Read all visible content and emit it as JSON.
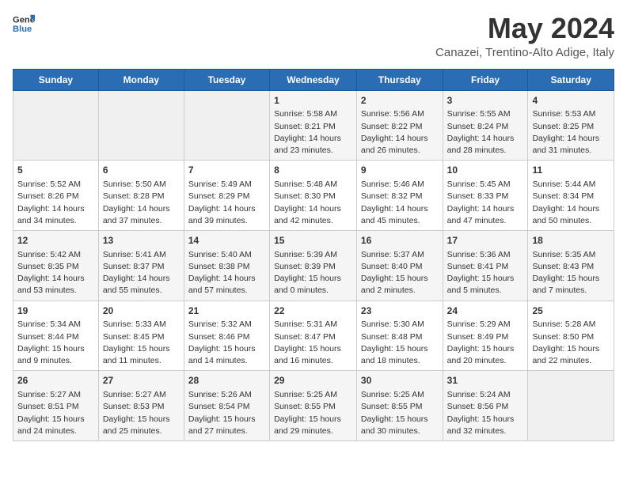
{
  "header": {
    "logo_general": "General",
    "logo_blue": "Blue",
    "title": "May 2024",
    "subtitle": "Canazei, Trentino-Alto Adige, Italy"
  },
  "calendar": {
    "days_of_week": [
      "Sunday",
      "Monday",
      "Tuesday",
      "Wednesday",
      "Thursday",
      "Friday",
      "Saturday"
    ],
    "weeks": [
      [
        {
          "day": "",
          "sunrise": "",
          "sunset": "",
          "daylight": ""
        },
        {
          "day": "",
          "sunrise": "",
          "sunset": "",
          "daylight": ""
        },
        {
          "day": "",
          "sunrise": "",
          "sunset": "",
          "daylight": ""
        },
        {
          "day": "1",
          "sunrise": "Sunrise: 5:58 AM",
          "sunset": "Sunset: 8:21 PM",
          "daylight": "Daylight: 14 hours and 23 minutes."
        },
        {
          "day": "2",
          "sunrise": "Sunrise: 5:56 AM",
          "sunset": "Sunset: 8:22 PM",
          "daylight": "Daylight: 14 hours and 26 minutes."
        },
        {
          "day": "3",
          "sunrise": "Sunrise: 5:55 AM",
          "sunset": "Sunset: 8:24 PM",
          "daylight": "Daylight: 14 hours and 28 minutes."
        },
        {
          "day": "4",
          "sunrise": "Sunrise: 5:53 AM",
          "sunset": "Sunset: 8:25 PM",
          "daylight": "Daylight: 14 hours and 31 minutes."
        }
      ],
      [
        {
          "day": "5",
          "sunrise": "Sunrise: 5:52 AM",
          "sunset": "Sunset: 8:26 PM",
          "daylight": "Daylight: 14 hours and 34 minutes."
        },
        {
          "day": "6",
          "sunrise": "Sunrise: 5:50 AM",
          "sunset": "Sunset: 8:28 PM",
          "daylight": "Daylight: 14 hours and 37 minutes."
        },
        {
          "day": "7",
          "sunrise": "Sunrise: 5:49 AM",
          "sunset": "Sunset: 8:29 PM",
          "daylight": "Daylight: 14 hours and 39 minutes."
        },
        {
          "day": "8",
          "sunrise": "Sunrise: 5:48 AM",
          "sunset": "Sunset: 8:30 PM",
          "daylight": "Daylight: 14 hours and 42 minutes."
        },
        {
          "day": "9",
          "sunrise": "Sunrise: 5:46 AM",
          "sunset": "Sunset: 8:32 PM",
          "daylight": "Daylight: 14 hours and 45 minutes."
        },
        {
          "day": "10",
          "sunrise": "Sunrise: 5:45 AM",
          "sunset": "Sunset: 8:33 PM",
          "daylight": "Daylight: 14 hours and 47 minutes."
        },
        {
          "day": "11",
          "sunrise": "Sunrise: 5:44 AM",
          "sunset": "Sunset: 8:34 PM",
          "daylight": "Daylight: 14 hours and 50 minutes."
        }
      ],
      [
        {
          "day": "12",
          "sunrise": "Sunrise: 5:42 AM",
          "sunset": "Sunset: 8:35 PM",
          "daylight": "Daylight: 14 hours and 53 minutes."
        },
        {
          "day": "13",
          "sunrise": "Sunrise: 5:41 AM",
          "sunset": "Sunset: 8:37 PM",
          "daylight": "Daylight: 14 hours and 55 minutes."
        },
        {
          "day": "14",
          "sunrise": "Sunrise: 5:40 AM",
          "sunset": "Sunset: 8:38 PM",
          "daylight": "Daylight: 14 hours and 57 minutes."
        },
        {
          "day": "15",
          "sunrise": "Sunrise: 5:39 AM",
          "sunset": "Sunset: 8:39 PM",
          "daylight": "Daylight: 15 hours and 0 minutes."
        },
        {
          "day": "16",
          "sunrise": "Sunrise: 5:37 AM",
          "sunset": "Sunset: 8:40 PM",
          "daylight": "Daylight: 15 hours and 2 minutes."
        },
        {
          "day": "17",
          "sunrise": "Sunrise: 5:36 AM",
          "sunset": "Sunset: 8:41 PM",
          "daylight": "Daylight: 15 hours and 5 minutes."
        },
        {
          "day": "18",
          "sunrise": "Sunrise: 5:35 AM",
          "sunset": "Sunset: 8:43 PM",
          "daylight": "Daylight: 15 hours and 7 minutes."
        }
      ],
      [
        {
          "day": "19",
          "sunrise": "Sunrise: 5:34 AM",
          "sunset": "Sunset: 8:44 PM",
          "daylight": "Daylight: 15 hours and 9 minutes."
        },
        {
          "day": "20",
          "sunrise": "Sunrise: 5:33 AM",
          "sunset": "Sunset: 8:45 PM",
          "daylight": "Daylight: 15 hours and 11 minutes."
        },
        {
          "day": "21",
          "sunrise": "Sunrise: 5:32 AM",
          "sunset": "Sunset: 8:46 PM",
          "daylight": "Daylight: 15 hours and 14 minutes."
        },
        {
          "day": "22",
          "sunrise": "Sunrise: 5:31 AM",
          "sunset": "Sunset: 8:47 PM",
          "daylight": "Daylight: 15 hours and 16 minutes."
        },
        {
          "day": "23",
          "sunrise": "Sunrise: 5:30 AM",
          "sunset": "Sunset: 8:48 PM",
          "daylight": "Daylight: 15 hours and 18 minutes."
        },
        {
          "day": "24",
          "sunrise": "Sunrise: 5:29 AM",
          "sunset": "Sunset: 8:49 PM",
          "daylight": "Daylight: 15 hours and 20 minutes."
        },
        {
          "day": "25",
          "sunrise": "Sunrise: 5:28 AM",
          "sunset": "Sunset: 8:50 PM",
          "daylight": "Daylight: 15 hours and 22 minutes."
        }
      ],
      [
        {
          "day": "26",
          "sunrise": "Sunrise: 5:27 AM",
          "sunset": "Sunset: 8:51 PM",
          "daylight": "Daylight: 15 hours and 24 minutes."
        },
        {
          "day": "27",
          "sunrise": "Sunrise: 5:27 AM",
          "sunset": "Sunset: 8:53 PM",
          "daylight": "Daylight: 15 hours and 25 minutes."
        },
        {
          "day": "28",
          "sunrise": "Sunrise: 5:26 AM",
          "sunset": "Sunset: 8:54 PM",
          "daylight": "Daylight: 15 hours and 27 minutes."
        },
        {
          "day": "29",
          "sunrise": "Sunrise: 5:25 AM",
          "sunset": "Sunset: 8:55 PM",
          "daylight": "Daylight: 15 hours and 29 minutes."
        },
        {
          "day": "30",
          "sunrise": "Sunrise: 5:25 AM",
          "sunset": "Sunset: 8:55 PM",
          "daylight": "Daylight: 15 hours and 30 minutes."
        },
        {
          "day": "31",
          "sunrise": "Sunrise: 5:24 AM",
          "sunset": "Sunset: 8:56 PM",
          "daylight": "Daylight: 15 hours and 32 minutes."
        },
        {
          "day": "",
          "sunrise": "",
          "sunset": "",
          "daylight": ""
        }
      ]
    ]
  }
}
